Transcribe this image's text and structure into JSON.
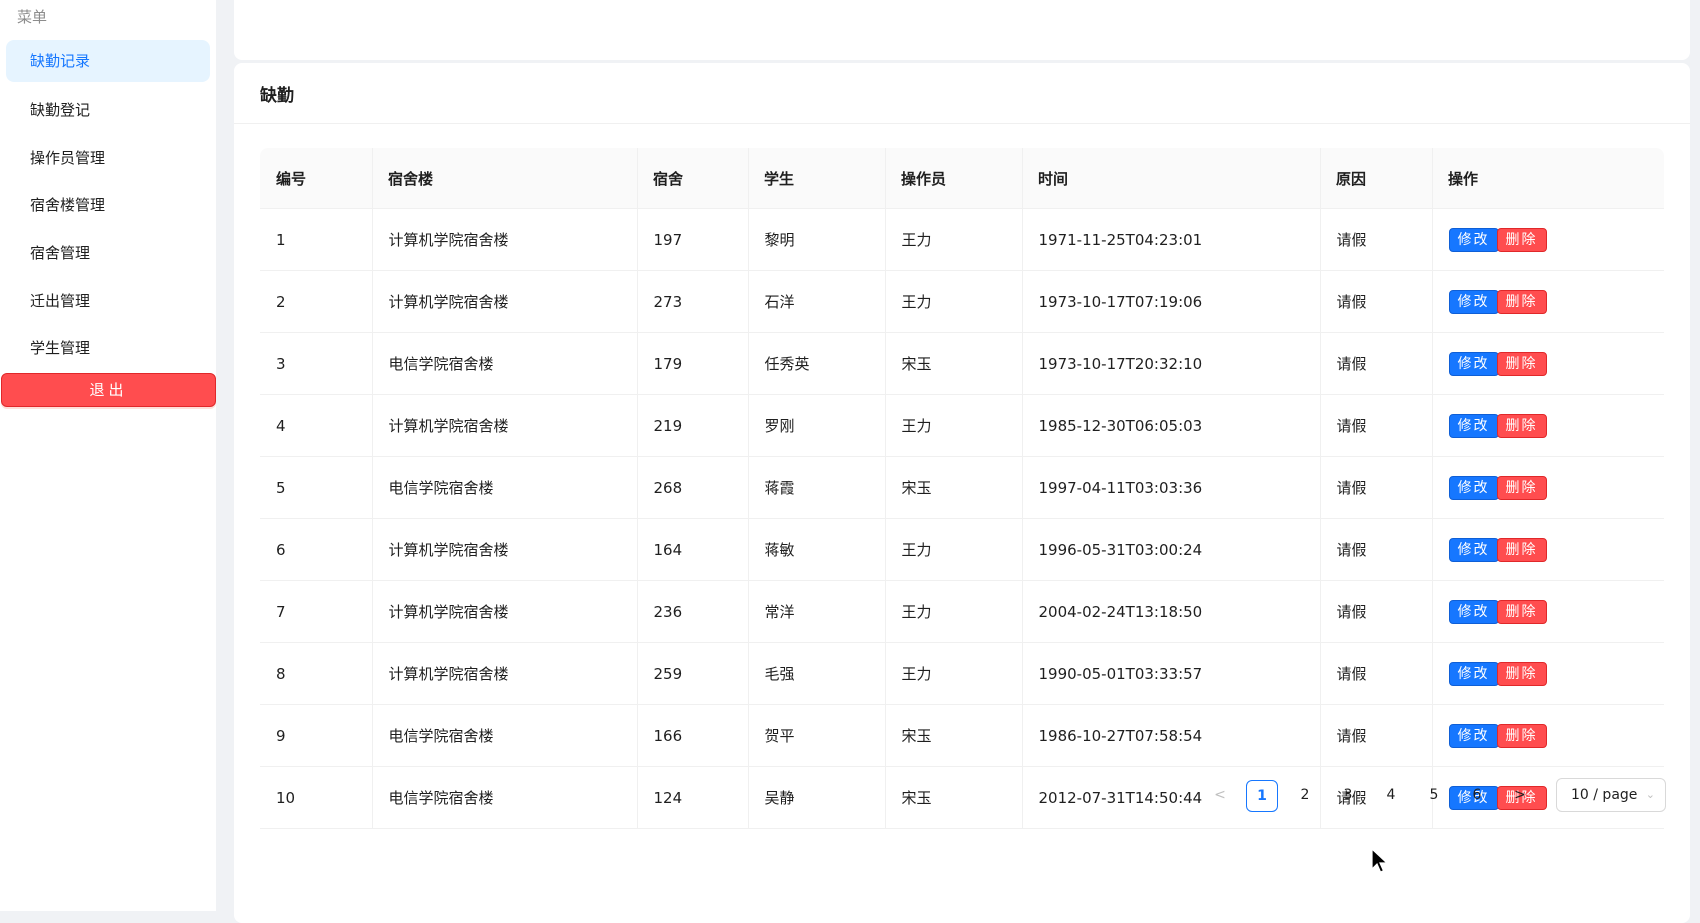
{
  "sidebar": {
    "menu_title": "菜单",
    "items": [
      {
        "label": "缺勤记录",
        "active": true
      },
      {
        "label": "缺勤登记",
        "active": false
      },
      {
        "label": "操作员管理",
        "active": false
      },
      {
        "label": "宿舍楼管理",
        "active": false
      },
      {
        "label": "宿舍管理",
        "active": false
      },
      {
        "label": "迁出管理",
        "active": false
      },
      {
        "label": "学生管理",
        "active": false
      }
    ],
    "logout_label": "退出"
  },
  "card": {
    "title": "缺勤"
  },
  "table": {
    "headers": [
      "编号",
      "宿舍楼",
      "宿舍",
      "学生",
      "操作员",
      "时间",
      "原因",
      "操作"
    ],
    "rows": [
      [
        "1",
        "计算机学院宿舍楼",
        "197",
        "黎明",
        "王力",
        "1971-11-25T04:23:01",
        "请假"
      ],
      [
        "2",
        "计算机学院宿舍楼",
        "273",
        "石洋",
        "王力",
        "1973-10-17T07:19:06",
        "请假"
      ],
      [
        "3",
        "电信学院宿舍楼",
        "179",
        "任秀英",
        "宋玉",
        "1973-10-17T20:32:10",
        "请假"
      ],
      [
        "4",
        "计算机学院宿舍楼",
        "219",
        "罗刚",
        "王力",
        "1985-12-30T06:05:03",
        "请假"
      ],
      [
        "5",
        "电信学院宿舍楼",
        "268",
        "蒋霞",
        "宋玉",
        "1997-04-11T03:03:36",
        "请假"
      ],
      [
        "6",
        "计算机学院宿舍楼",
        "164",
        "蒋敏",
        "王力",
        "1996-05-31T03:00:24",
        "请假"
      ],
      [
        "7",
        "计算机学院宿舍楼",
        "236",
        "常洋",
        "王力",
        "2004-02-24T13:18:50",
        "请假"
      ],
      [
        "8",
        "计算机学院宿舍楼",
        "259",
        "毛强",
        "王力",
        "1990-05-01T03:33:57",
        "请假"
      ],
      [
        "9",
        "电信学院宿舍楼",
        "166",
        "贺平",
        "宋玉",
        "1986-10-27T07:58:54",
        "请假"
      ],
      [
        "10",
        "电信学院宿舍楼",
        "124",
        "吴静",
        "宋玉",
        "2012-07-31T14:50:44",
        "请假"
      ]
    ],
    "edit_label": "修改",
    "delete_label": "删除"
  },
  "pagination": {
    "prev": "<",
    "next": ">",
    "pages": [
      "1",
      "2",
      "3",
      "4",
      "5",
      "6"
    ],
    "current": "1",
    "page_size": "10 / page"
  },
  "colors": {
    "primary": "#1677ff",
    "danger": "#ff4d4f",
    "active_menu_bg": "#e6f4ff"
  }
}
